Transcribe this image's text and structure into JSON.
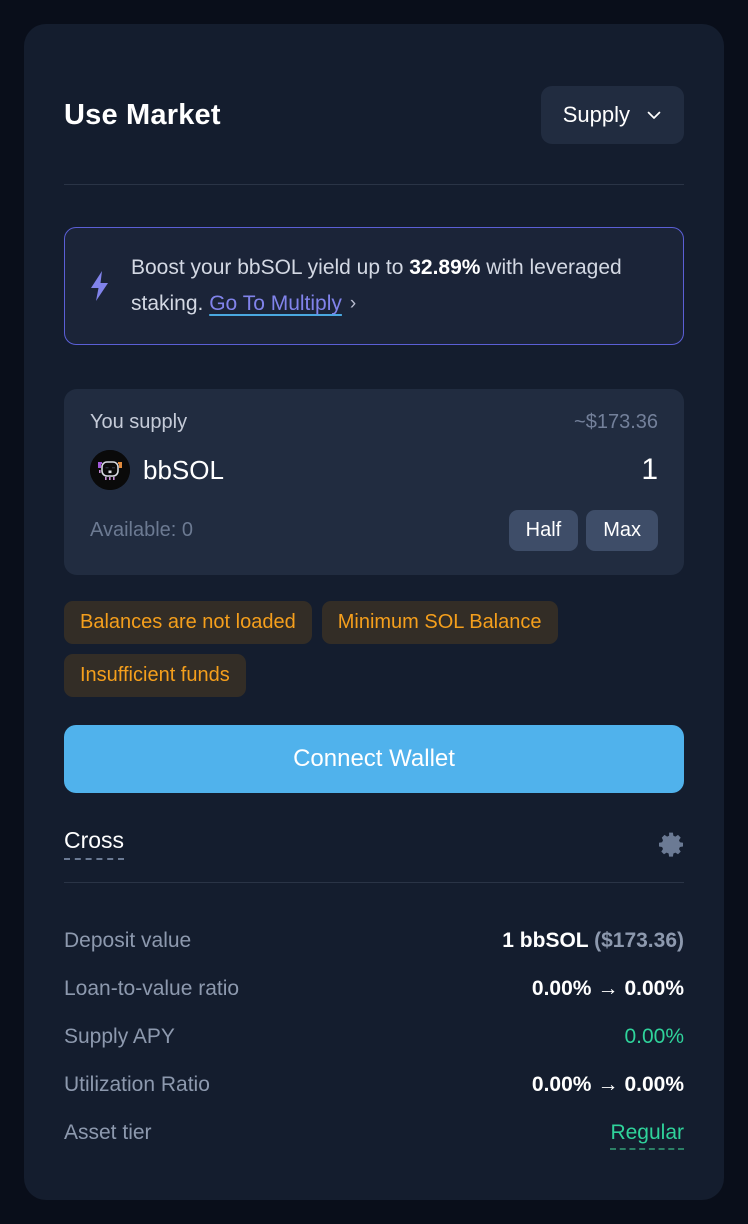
{
  "header": {
    "title": "Use Market",
    "mode_button": {
      "label": "Supply",
      "icon": "chevron-down-icon"
    }
  },
  "promo": {
    "icon": "lightning-bolt-icon",
    "text_before": "Boost your bbSOL yield up to ",
    "highlight": "32.89%",
    "text_after": " with leveraged staking. ",
    "link_label": "Go To Multiply",
    "link_arrow": "›",
    "border_color": "#5b5fd6",
    "accent_color": "#8183eb"
  },
  "supply": {
    "label": "You supply",
    "usd_value": "~$173.36",
    "token_symbol": "bbSOL",
    "token_icon": "bbsol-token-icon",
    "amount": "1",
    "amount_placeholder": "0",
    "available": "Available: 0",
    "half_label": "Half",
    "max_label": "Max"
  },
  "warnings": [
    "Balances are not loaded",
    "Minimum SOL Balance",
    "Insufficient funds"
  ],
  "cta": {
    "label": "Connect Wallet",
    "color": "#50b2ec"
  },
  "mode_row": {
    "label": "Cross",
    "settings_icon": "gear-icon"
  },
  "stats": [
    {
      "key": "Deposit value",
      "value": "1 bbSOL",
      "suffix": "($173.36)",
      "style": "split"
    },
    {
      "key": "Loan-to-value ratio",
      "from": "0.00%",
      "arrow": "→",
      "to": "0.00%",
      "style": "transition"
    },
    {
      "key": "Supply APY",
      "value": "0.00%",
      "style": "green"
    },
    {
      "key": "Utilization Ratio",
      "from": "0.00%",
      "arrow": "→",
      "to": "0.00%",
      "style": "transition"
    },
    {
      "key": "Asset tier",
      "value": "Regular",
      "style": "green-dashed"
    }
  ],
  "colors": {
    "page_background": "#090e1a",
    "card_background": "#141d2e",
    "inner_background": "#212c40",
    "positive": "#2fd39b",
    "warning_text": "#f59f1c",
    "warning_bg": "#332d26",
    "accent_blue": "#50b2ec"
  }
}
